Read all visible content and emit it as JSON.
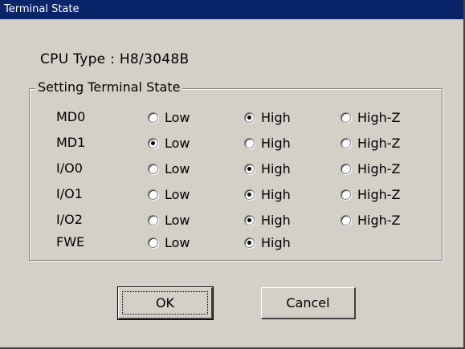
{
  "window": {
    "title": "Terminal State"
  },
  "cpu": {
    "label": "CPU Type",
    "separator": ":",
    "value": "H8/3048B",
    "text": "CPU Type : H8/3048B"
  },
  "group": {
    "legend": "Setting Terminal State"
  },
  "options": {
    "low": "Low",
    "high": "High",
    "hiz": "High-Z"
  },
  "terminals": [
    {
      "name": "MD0",
      "selected": "high",
      "has_hiz": true
    },
    {
      "name": "MD1",
      "selected": "low",
      "has_hiz": true
    },
    {
      "name": "I/O0",
      "selected": "high",
      "has_hiz": true
    },
    {
      "name": "I/O1",
      "selected": "high",
      "has_hiz": true
    },
    {
      "name": "I/O2",
      "selected": "high",
      "has_hiz": true
    },
    {
      "name": "FWE",
      "selected": "high",
      "has_hiz": false
    }
  ],
  "buttons": {
    "ok": "OK",
    "cancel": "Cancel"
  }
}
